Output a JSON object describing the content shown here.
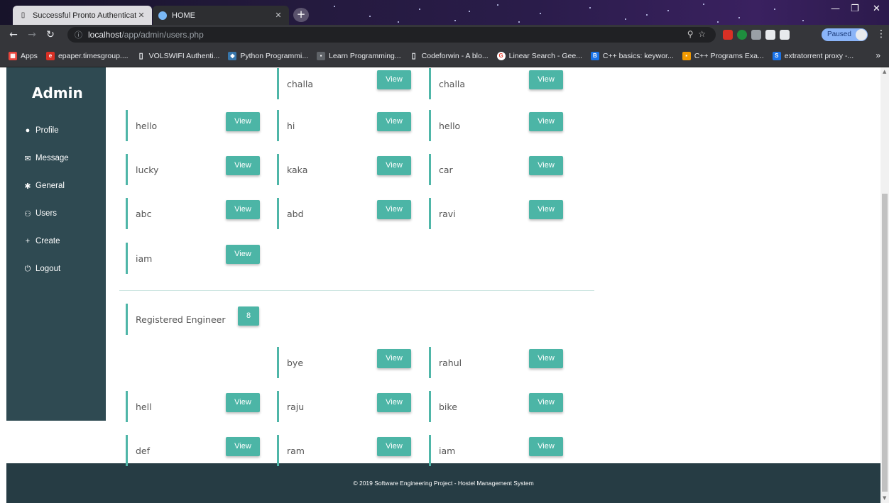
{
  "browser": {
    "tabs": [
      {
        "label": "Successful Pronto Authentication",
        "active": false
      },
      {
        "label": "HOME",
        "active": true
      }
    ],
    "url_host": "localhost",
    "url_path": "/app/admin/users.php",
    "status_pill": "Paused",
    "bookmarks": [
      {
        "label": "Apps",
        "icon": "apps-grid-icon",
        "color": "#e8453c"
      },
      {
        "label": "epaper.timesgroup....",
        "icon": "epaper-icon",
        "color": "#d93025"
      },
      {
        "label": "VOLSWIFI Authenti...",
        "icon": "page-icon",
        "color": "#9aa0a6"
      },
      {
        "label": "Python Programmi...",
        "icon": "python-icon",
        "color": "#3776ab"
      },
      {
        "label": "Learn Programming...",
        "icon": "learn-icon",
        "color": "#5f6368"
      },
      {
        "label": "Codeforwin - A blo...",
        "icon": "page-icon",
        "color": "#9aa0a6"
      },
      {
        "label": "Linear Search - Gee...",
        "icon": "google-icon",
        "color": "#ea4335"
      },
      {
        "label": "C++ basics: keywor...",
        "icon": "cpp-basics-icon",
        "color": "#1a73e8"
      },
      {
        "label": "C++ Programs Exa...",
        "icon": "cpp-programs-icon",
        "color": "#f29900"
      },
      {
        "label": "extratorrent proxy -...",
        "icon": "is-icon",
        "color": "#1a73e8"
      }
    ]
  },
  "sidebar": {
    "title": "Admin",
    "items": [
      {
        "label": "Profile",
        "icon": "user-circle-icon"
      },
      {
        "label": "Message",
        "icon": "envelope-open-icon"
      },
      {
        "label": "General",
        "icon": "cog-icon"
      },
      {
        "label": "Users",
        "icon": "users-icon"
      },
      {
        "label": "Create",
        "icon": "plus-icon"
      },
      {
        "label": "Logout",
        "icon": "power-icon"
      }
    ]
  },
  "users_section_a": [
    [
      null,
      "challa",
      "challa"
    ],
    [
      "hello",
      "hi",
      "hello"
    ],
    [
      "lucky",
      "kaka",
      "car"
    ],
    [
      "abc",
      "abd",
      "ravi"
    ],
    [
      "iam",
      null,
      null
    ]
  ],
  "registered": {
    "label": "Registered Engineer",
    "count": "8"
  },
  "users_section_b": [
    [
      null,
      "bye",
      "rahul"
    ],
    [
      "hell",
      "raju",
      "bike"
    ],
    [
      "def",
      "ram",
      "iam"
    ]
  ],
  "view_label": "View",
  "footer": "© 2019 Software Engineering Project - Hostel Management System",
  "colors": {
    "sidebar": "#2f4a52",
    "accent": "#4cb5a6",
    "footer": "#263c44"
  }
}
